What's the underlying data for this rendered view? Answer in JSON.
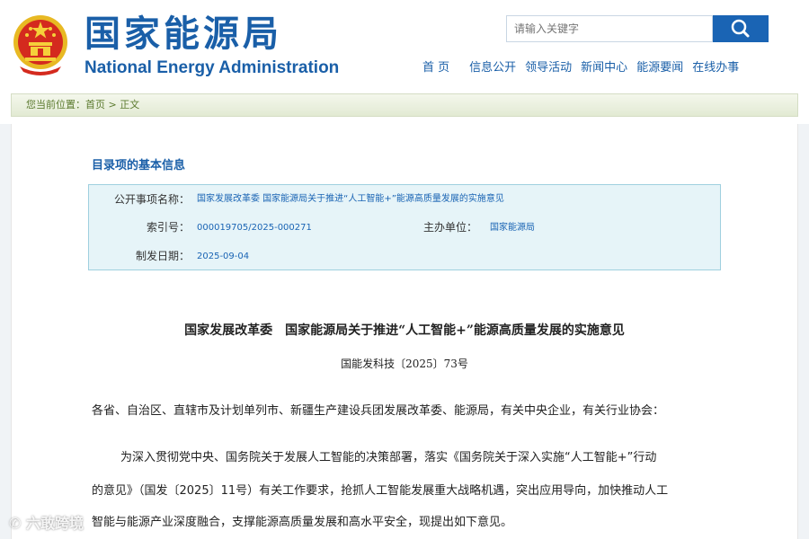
{
  "header": {
    "title_cn": "国家能源局",
    "title_en": "National Energy Administration",
    "emblem_icon": "national-emblem-icon"
  },
  "search": {
    "placeholder": "请输入关键字",
    "button_icon": "search-icon"
  },
  "nav": {
    "items": [
      "首 页",
      "信息公开",
      "领导活动",
      "新闻中心",
      "能源要闻",
      "在线办事"
    ]
  },
  "breadcrumb": {
    "prefix": "您当前位置：",
    "home": "首页",
    "separator": ">",
    "current": "正文"
  },
  "info": {
    "title": "目录项的基本信息",
    "public_item_label": "公开事项名称：",
    "public_item_value": "国家发展改革委 国家能源局关于推进“人工智能+”能源高质量发展的实施意见",
    "index_label": "索引号：",
    "index_value": "000019705/2025-000271",
    "host_label": "主办单位：",
    "host_value": "国家能源局",
    "date_label": "制发日期：",
    "date_value": "2025-09-04"
  },
  "document": {
    "title": "国家发展改革委　国家能源局关于推进“人工智能+”能源高质量发展的实施意见",
    "number": "国能发科技〔2025〕73号",
    "addressee": "各省、自治区、直辖市及计划单列市、新疆生产建设兵团发展改革委、能源局，有关中央企业，有关行业协会：",
    "para1_line1": "为深入贯彻党中央、国务院关于发展人工智能的决策部署，落实《国务院关于深入实施“人工智能+”行动",
    "para1_line2": "的意见》（国发〔2025〕11号）有关工作要求，抢抓人工智能发展重大战略机遇，突出应用导向，加快推动人工",
    "para1_line3": "智能与能源产业深度融合，支撑能源高质量发展和高水平安全，现提出如下意见。"
  },
  "watermark": {
    "text": "六敢跨境"
  },
  "colors": {
    "brand_blue": "#1a5fa8",
    "search_button": "#1a64b4",
    "info_box_bg": "#e6f4f8",
    "info_box_border": "#9fd0df",
    "breadcrumb_text": "#5b7a2e"
  }
}
